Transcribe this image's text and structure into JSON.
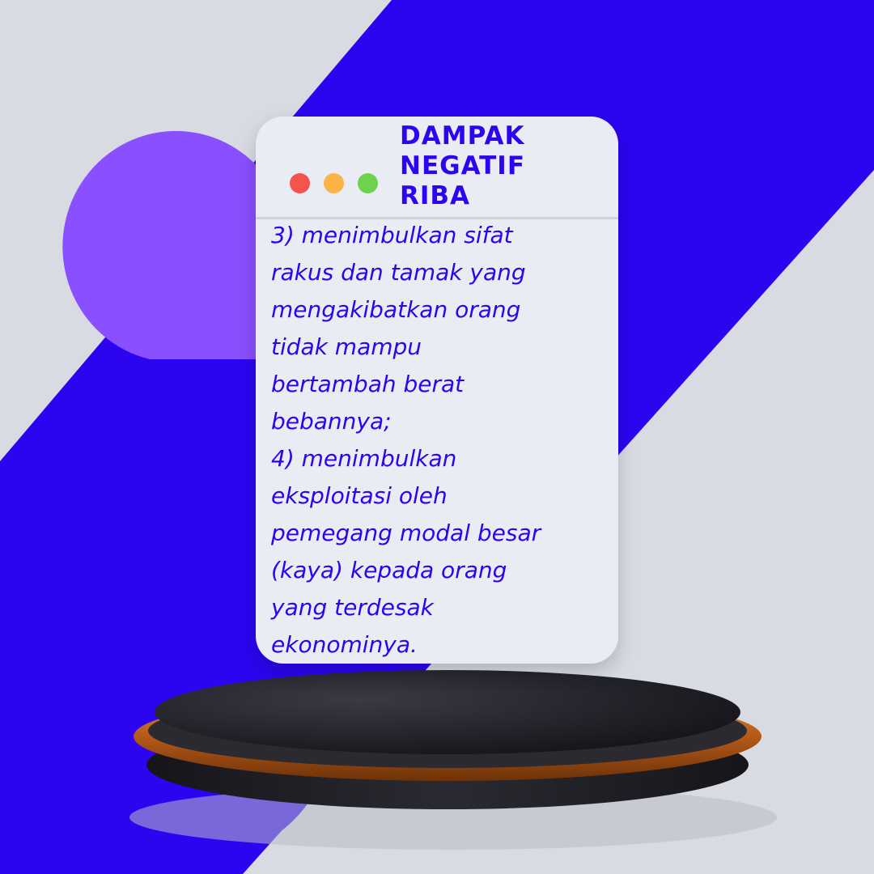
{
  "colors": {
    "background": "#d9dbe3",
    "blue_band": "#2c04ef",
    "purple_circle": "#8a4ffe",
    "card": "#e9ecf2",
    "title": "#2c04ef",
    "body_text": "#2c04ef",
    "dot_red": "#f4544d",
    "dot_yellow": "#fbb247",
    "dot_green": "#6ed24c",
    "podium_top": "#1b1b22",
    "podium_ring": "#c86a22"
  },
  "window_controls": [
    "close-dot",
    "minimize-dot",
    "maximize-dot"
  ],
  "card": {
    "title": "DAMPAK\nNEGATIF\nRIBA",
    "lines": [
      "3) menimbulkan sifat",
      "rakus dan tamak yang",
      "mengakibatkan orang",
      "tidak mampu",
      "bertambah berat",
      "bebannya;",
      "4) menimbulkan",
      "eksploitasi oleh",
      "pemegang modal besar",
      "(kaya) kepada orang",
      "yang terdesak",
      "ekonominya."
    ]
  }
}
